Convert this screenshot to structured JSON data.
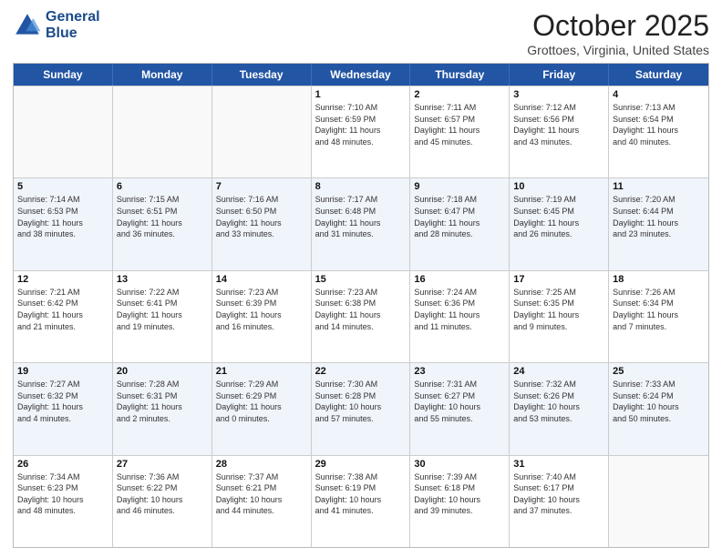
{
  "logo": {
    "line1": "General",
    "line2": "Blue"
  },
  "title": "October 2025",
  "subtitle": "Grottoes, Virginia, United States",
  "days_of_week": [
    "Sunday",
    "Monday",
    "Tuesday",
    "Wednesday",
    "Thursday",
    "Friday",
    "Saturday"
  ],
  "weeks": [
    [
      {
        "day": "",
        "info": ""
      },
      {
        "day": "",
        "info": ""
      },
      {
        "day": "",
        "info": ""
      },
      {
        "day": "1",
        "info": "Sunrise: 7:10 AM\nSunset: 6:59 PM\nDaylight: 11 hours\nand 48 minutes."
      },
      {
        "day": "2",
        "info": "Sunrise: 7:11 AM\nSunset: 6:57 PM\nDaylight: 11 hours\nand 45 minutes."
      },
      {
        "day": "3",
        "info": "Sunrise: 7:12 AM\nSunset: 6:56 PM\nDaylight: 11 hours\nand 43 minutes."
      },
      {
        "day": "4",
        "info": "Sunrise: 7:13 AM\nSunset: 6:54 PM\nDaylight: 11 hours\nand 40 minutes."
      }
    ],
    [
      {
        "day": "5",
        "info": "Sunrise: 7:14 AM\nSunset: 6:53 PM\nDaylight: 11 hours\nand 38 minutes."
      },
      {
        "day": "6",
        "info": "Sunrise: 7:15 AM\nSunset: 6:51 PM\nDaylight: 11 hours\nand 36 minutes."
      },
      {
        "day": "7",
        "info": "Sunrise: 7:16 AM\nSunset: 6:50 PM\nDaylight: 11 hours\nand 33 minutes."
      },
      {
        "day": "8",
        "info": "Sunrise: 7:17 AM\nSunset: 6:48 PM\nDaylight: 11 hours\nand 31 minutes."
      },
      {
        "day": "9",
        "info": "Sunrise: 7:18 AM\nSunset: 6:47 PM\nDaylight: 11 hours\nand 28 minutes."
      },
      {
        "day": "10",
        "info": "Sunrise: 7:19 AM\nSunset: 6:45 PM\nDaylight: 11 hours\nand 26 minutes."
      },
      {
        "day": "11",
        "info": "Sunrise: 7:20 AM\nSunset: 6:44 PM\nDaylight: 11 hours\nand 23 minutes."
      }
    ],
    [
      {
        "day": "12",
        "info": "Sunrise: 7:21 AM\nSunset: 6:42 PM\nDaylight: 11 hours\nand 21 minutes."
      },
      {
        "day": "13",
        "info": "Sunrise: 7:22 AM\nSunset: 6:41 PM\nDaylight: 11 hours\nand 19 minutes."
      },
      {
        "day": "14",
        "info": "Sunrise: 7:23 AM\nSunset: 6:39 PM\nDaylight: 11 hours\nand 16 minutes."
      },
      {
        "day": "15",
        "info": "Sunrise: 7:23 AM\nSunset: 6:38 PM\nDaylight: 11 hours\nand 14 minutes."
      },
      {
        "day": "16",
        "info": "Sunrise: 7:24 AM\nSunset: 6:36 PM\nDaylight: 11 hours\nand 11 minutes."
      },
      {
        "day": "17",
        "info": "Sunrise: 7:25 AM\nSunset: 6:35 PM\nDaylight: 11 hours\nand 9 minutes."
      },
      {
        "day": "18",
        "info": "Sunrise: 7:26 AM\nSunset: 6:34 PM\nDaylight: 11 hours\nand 7 minutes."
      }
    ],
    [
      {
        "day": "19",
        "info": "Sunrise: 7:27 AM\nSunset: 6:32 PM\nDaylight: 11 hours\nand 4 minutes."
      },
      {
        "day": "20",
        "info": "Sunrise: 7:28 AM\nSunset: 6:31 PM\nDaylight: 11 hours\nand 2 minutes."
      },
      {
        "day": "21",
        "info": "Sunrise: 7:29 AM\nSunset: 6:29 PM\nDaylight: 11 hours\nand 0 minutes."
      },
      {
        "day": "22",
        "info": "Sunrise: 7:30 AM\nSunset: 6:28 PM\nDaylight: 10 hours\nand 57 minutes."
      },
      {
        "day": "23",
        "info": "Sunrise: 7:31 AM\nSunset: 6:27 PM\nDaylight: 10 hours\nand 55 minutes."
      },
      {
        "day": "24",
        "info": "Sunrise: 7:32 AM\nSunset: 6:26 PM\nDaylight: 10 hours\nand 53 minutes."
      },
      {
        "day": "25",
        "info": "Sunrise: 7:33 AM\nSunset: 6:24 PM\nDaylight: 10 hours\nand 50 minutes."
      }
    ],
    [
      {
        "day": "26",
        "info": "Sunrise: 7:34 AM\nSunset: 6:23 PM\nDaylight: 10 hours\nand 48 minutes."
      },
      {
        "day": "27",
        "info": "Sunrise: 7:36 AM\nSunset: 6:22 PM\nDaylight: 10 hours\nand 46 minutes."
      },
      {
        "day": "28",
        "info": "Sunrise: 7:37 AM\nSunset: 6:21 PM\nDaylight: 10 hours\nand 44 minutes."
      },
      {
        "day": "29",
        "info": "Sunrise: 7:38 AM\nSunset: 6:19 PM\nDaylight: 10 hours\nand 41 minutes."
      },
      {
        "day": "30",
        "info": "Sunrise: 7:39 AM\nSunset: 6:18 PM\nDaylight: 10 hours\nand 39 minutes."
      },
      {
        "day": "31",
        "info": "Sunrise: 7:40 AM\nSunset: 6:17 PM\nDaylight: 10 hours\nand 37 minutes."
      },
      {
        "day": "",
        "info": ""
      }
    ]
  ]
}
